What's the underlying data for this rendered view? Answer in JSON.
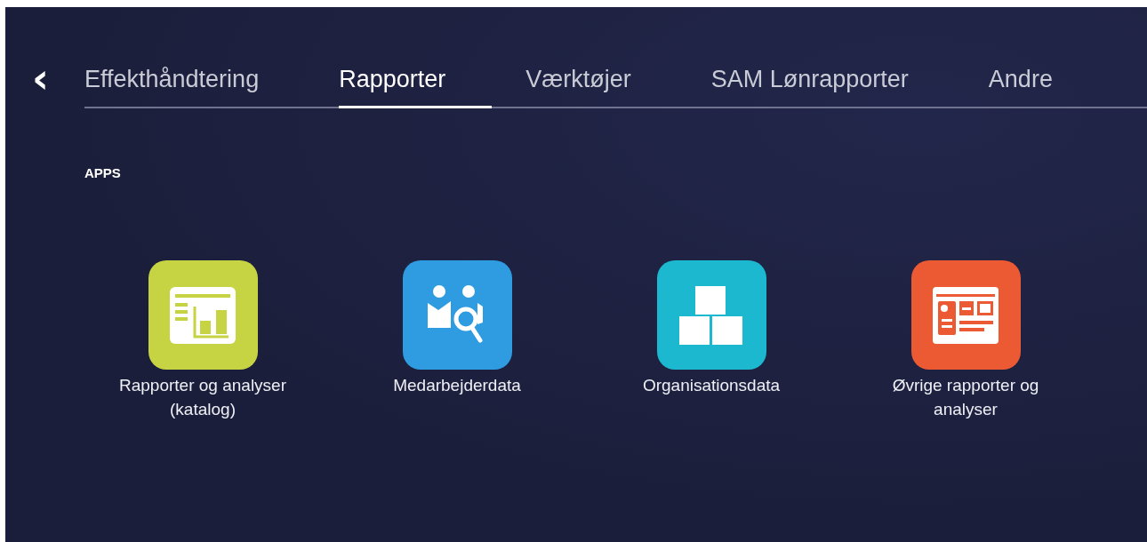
{
  "back_button": {
    "label": "‹"
  },
  "tabs": [
    {
      "label": "Effekthåndtering",
      "selected": false
    },
    {
      "label": "Rapporter",
      "selected": true
    },
    {
      "label": "Værktøjer",
      "selected": false
    },
    {
      "label": "SAM Lønrapporter",
      "selected": false
    },
    {
      "label": "Andre",
      "selected": false
    }
  ],
  "section": {
    "title": "APPS"
  },
  "apps": [
    {
      "label": "Rapporter og analyser (katalog)",
      "kind": "report",
      "color": "#c6d443"
    },
    {
      "label": "Medarbejderdata",
      "kind": "people",
      "color": "#2f9be0"
    },
    {
      "label": "Organisationsdata",
      "kind": "blocks",
      "color": "#1cb8d0"
    },
    {
      "label": "Øvrige rapporter og analyser",
      "kind": "dashboard",
      "color": "#ec5a33"
    }
  ]
}
